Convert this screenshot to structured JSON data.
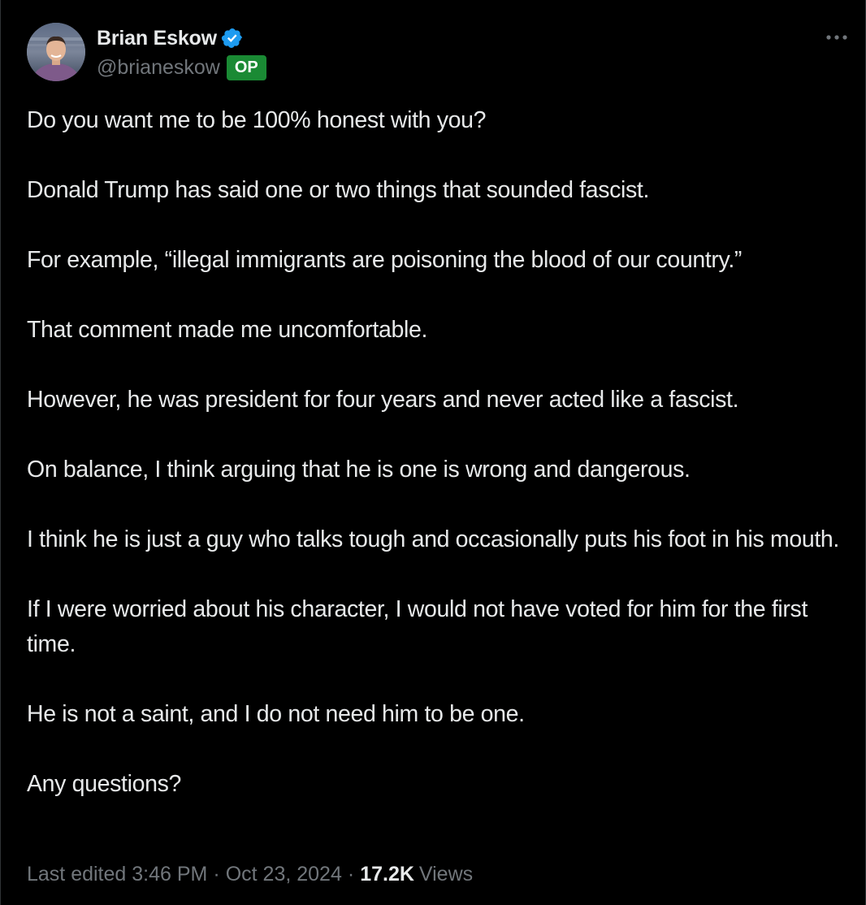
{
  "author": {
    "display_name": "Brian Eskow",
    "handle": "@brianeskow",
    "badge": "OP",
    "verified": true
  },
  "colors": {
    "background": "#000000",
    "text_primary": "#e7e9ea",
    "text_secondary": "#71767b",
    "verified_blue": "#1d9bf0",
    "op_badge_green": "#1a8a34"
  },
  "icons": {
    "verified": "verified-badge-icon",
    "more": "more-options-icon"
  },
  "post": {
    "paragraphs": [
      "Do you want me to be 100% honest with you?",
      "Donald Trump has said one or two things that sounded fascist.",
      "For example, “illegal immigrants are poisoning the blood of our country.”",
      "That comment made me uncomfortable.",
      "However, he was president for four years and never acted like a fascist.",
      "On balance, I think arguing that he is one is wrong and dangerous.",
      "I think he is just a guy who talks tough and occasionally puts his foot in his mouth.",
      "If I were worried about his character, I would not have voted for him for the first time.",
      "He is not a saint, and I do not need him to be one.",
      "Any questions?"
    ]
  },
  "meta": {
    "edited_label": "Last edited 3:46 PM",
    "separator": "·",
    "date": "Oct 23, 2024",
    "views_count": "17.2K",
    "views_label": "Views"
  }
}
